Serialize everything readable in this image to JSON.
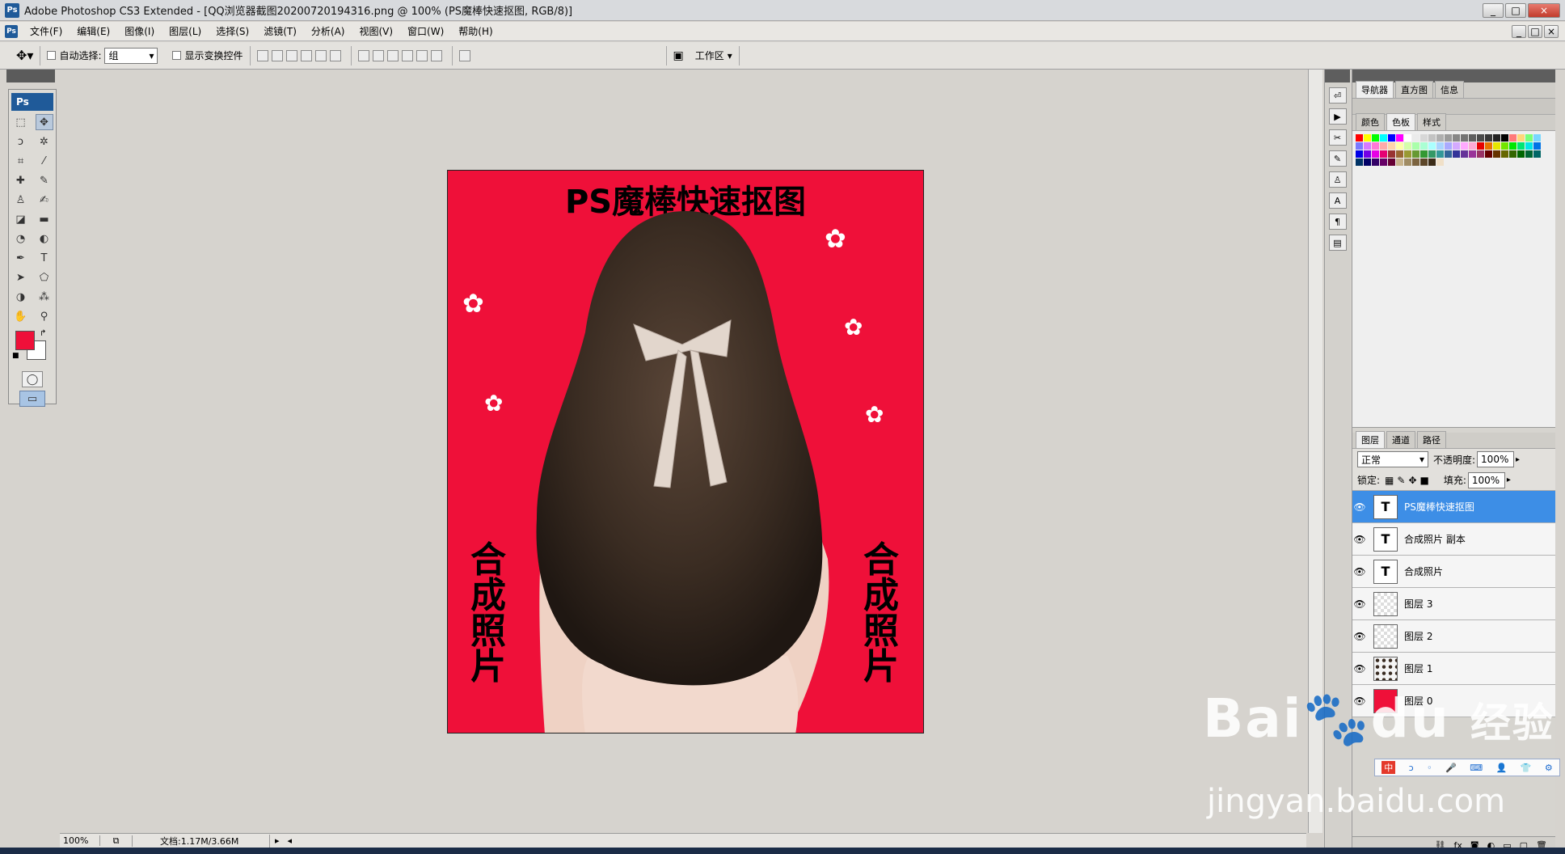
{
  "window": {
    "title": "Adobe Photoshop CS3 Extended - [QQ浏览器截图20200720194316.png @ 100% (PS魔棒快速抠图, RGB/8)]",
    "ps_badge": "Ps",
    "min": "_",
    "max": "□",
    "close": "×"
  },
  "menu": [
    "文件(F)",
    "编辑(E)",
    "图像(I)",
    "图层(L)",
    "选择(S)",
    "滤镜(T)",
    "分析(A)",
    "视图(V)",
    "窗口(W)",
    "帮助(H)"
  ],
  "options": {
    "auto_select_label": "自动选择:",
    "auto_select_value": "组",
    "show_transform_label": "显示变换控件",
    "workspace_label": "工作区"
  },
  "toolbox": {
    "badge": "Ps",
    "foreground_color": "#ef1039",
    "background_color": "#ffffff"
  },
  "canvas": {
    "title": "PS魔棒快速抠图",
    "left_text": "合成照片",
    "right_text": "合成照片",
    "bg_color": "#ef1039"
  },
  "status": {
    "zoom": "100%",
    "doc_info": "文档:1.17M/3.66M"
  },
  "panels": {
    "nav_tabs": [
      "导航器",
      "直方图",
      "信息"
    ],
    "color_tabs": [
      "颜色",
      "色板",
      "样式"
    ],
    "layers_tabs": [
      "图层",
      "通道",
      "路径"
    ],
    "blend_mode": "正常",
    "opacity_label": "不透明度:",
    "opacity_value": "100%",
    "lock_label": "锁定:",
    "fill_label": "填充:",
    "fill_value": "100%",
    "layers": [
      {
        "name": "PS魔棒快速抠图",
        "type": "text",
        "selected": true
      },
      {
        "name": "合成照片 副本",
        "type": "text",
        "selected": false
      },
      {
        "name": "合成照片",
        "type": "text",
        "selected": false
      },
      {
        "name": "图层 3",
        "type": "empty",
        "selected": false
      },
      {
        "name": "图层 2",
        "type": "empty",
        "selected": false
      },
      {
        "name": "图层 1",
        "type": "photo",
        "selected": false
      },
      {
        "name": "图层 0",
        "type": "red",
        "selected": false
      }
    ]
  },
  "swatches": [
    "#ff0000",
    "#ffff00",
    "#00ff00",
    "#00ffff",
    "#0000ff",
    "#ff00ff",
    "#ffffff",
    "#ebebeb",
    "#d7d7d7",
    "#c3c3c3",
    "#afafaf",
    "#9b9b9b",
    "#878787",
    "#737373",
    "#5f5f5f",
    "#4b4b4b",
    "#373737",
    "#232323",
    "#000000",
    "#ff7979",
    "#ffd779",
    "#79ff79",
    "#79d7ff",
    "#7979ff",
    "#d779ff",
    "#ff79d7",
    "#ffaaaa",
    "#ffd4aa",
    "#ffffaa",
    "#d4ffaa",
    "#aaffaa",
    "#aaffd4",
    "#aaffff",
    "#aad4ff",
    "#aaaaff",
    "#d4aaff",
    "#ffaaff",
    "#ffaad4",
    "#e60000",
    "#e67300",
    "#e6e600",
    "#73e600",
    "#00e600",
    "#00e673",
    "#00e6e6",
    "#0073e6",
    "#0000e6",
    "#7300e6",
    "#e600e6",
    "#e60073",
    "#993333",
    "#996633",
    "#999933",
    "#669933",
    "#339933",
    "#339966",
    "#339999",
    "#336699",
    "#333399",
    "#663399",
    "#993399",
    "#993366",
    "#660000",
    "#663300",
    "#666600",
    "#336600",
    "#006600",
    "#006633",
    "#006666",
    "#003366",
    "#000066",
    "#330066",
    "#660066",
    "#660033",
    "#c8b48c",
    "#a08c64",
    "#7c6440",
    "#5c4628",
    "#3c2c18",
    "#f0e0c8"
  ],
  "watermark": {
    "brand": "Bai",
    "brand2": "du",
    "product": "经验",
    "url": "jingyan.baidu.com"
  },
  "ime": [
    "中",
    "ↄ",
    "◦",
    "🎤",
    "⌨",
    "👤",
    "👕",
    "⚙"
  ]
}
